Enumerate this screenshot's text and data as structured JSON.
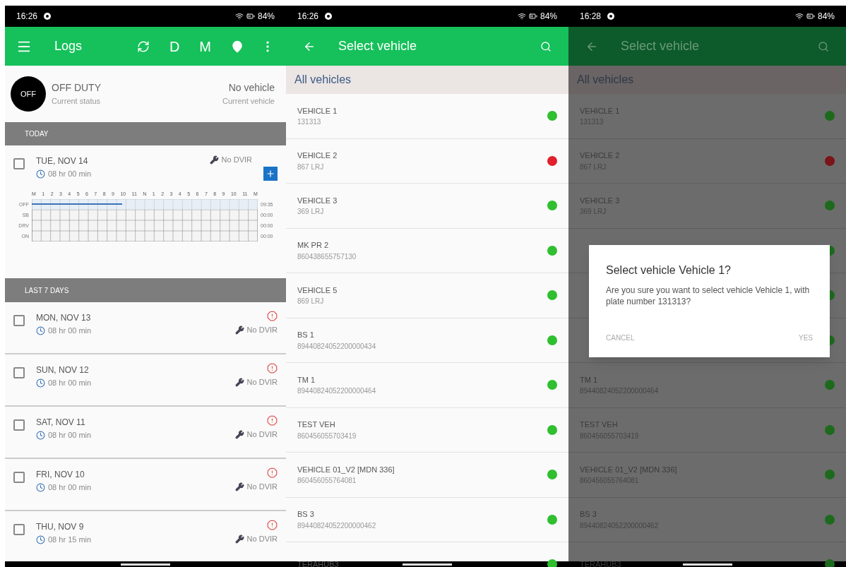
{
  "screens": [
    {
      "kind": "logs",
      "status_bar": {
        "time": "16:26",
        "battery": "84%"
      },
      "toolbar": {
        "title": "Logs",
        "actions": [
          "D",
          "M"
        ]
      },
      "current": {
        "badge": "OFF",
        "status": "OFF DUTY",
        "status_caption": "Current status",
        "vehicle": "No vehicle",
        "vehicle_caption": "Current vehicle"
      },
      "today": {
        "header": "TODAY",
        "day": {
          "date": "TUE, NOV 14",
          "checked": false,
          "duration": "08 hr 00 min",
          "dvir": "No DVIR"
        },
        "grid": {
          "hours": [
            "M",
            "1",
            "2",
            "3",
            "4",
            "5",
            "6",
            "7",
            "8",
            "9",
            "10",
            "11",
            "N",
            "1",
            "2",
            "3",
            "4",
            "5",
            "6",
            "7",
            "8",
            "9",
            "10",
            "11",
            "M"
          ],
          "rows": [
            {
              "label": "OFF",
              "total": "09:35",
              "level": 0.4
            },
            {
              "label": "SB",
              "total": "00:00"
            },
            {
              "label": "DRV",
              "total": "00:00"
            },
            {
              "label": "ON",
              "total": "00:00"
            }
          ]
        }
      },
      "last7": {
        "header": "LAST 7 DAYS",
        "days": [
          {
            "date": "MON, NOV 13",
            "checked": false,
            "duration": "08 hr 00 min",
            "dvir": "No DVIR"
          },
          {
            "date": "SUN, NOV 12",
            "checked": false,
            "duration": "08 hr 00 min",
            "dvir": "No DVIR"
          },
          {
            "date": "SAT, NOV 11",
            "checked": false,
            "duration": "08 hr 00 min",
            "dvir": "No DVIR"
          },
          {
            "date": "FRI, NOV 10",
            "checked": false,
            "duration": "08 hr 00 min",
            "dvir": "No DVIR"
          },
          {
            "date": "THU, NOV 9",
            "checked": false,
            "duration": "08 hr 15 min",
            "dvir": "No DVIR"
          }
        ]
      }
    },
    {
      "kind": "vehicles",
      "dimmed": false,
      "status_bar": {
        "time": "16:26",
        "battery": "84%"
      },
      "toolbar": {
        "title": "Select vehicle"
      },
      "section": "All vehicles",
      "vehicles": [
        {
          "kind": "row",
          "name": "VEHICLE 1",
          "plate": "131313",
          "color": "#2fbf2f"
        },
        {
          "kind": "row",
          "name": "VEHICLE 2",
          "plate": "867 LRJ",
          "color": "#e0202c"
        },
        {
          "kind": "row",
          "name": "VEHICLE 3",
          "plate": "369 LRJ",
          "color": "#2fbf2f"
        },
        {
          "kind": "row",
          "name": "MK PR 2",
          "plate": "860438655757130",
          "color": "#2fbf2f"
        },
        {
          "kind": "row",
          "name": "VEHICLE 5",
          "plate": "869 LRJ",
          "color": "#2fbf2f"
        },
        {
          "kind": "row",
          "name": "BS 1",
          "plate": "89440824052200000434",
          "color": "#2fbf2f"
        },
        {
          "kind": "row",
          "name": "TM 1",
          "plate": "89440824052200000464",
          "color": "#2fbf2f"
        },
        {
          "kind": "row",
          "name": "TEST VEH",
          "plate": "860456055703419",
          "color": "#2fbf2f"
        },
        {
          "kind": "row",
          "name": "VEHICLE 01_V2 [MDN 336]",
          "plate": "860456055764081",
          "color": "#2fbf2f"
        },
        {
          "kind": "row",
          "name": "BS 3",
          "plate": "89440824052200000462",
          "color": "#2fbf2f"
        },
        {
          "kind": "row",
          "name": "TERAHUB3",
          "color": "#2fbf2f"
        }
      ]
    },
    {
      "kind": "vehicles",
      "dimmed": true,
      "status_bar": {
        "time": "16:28",
        "battery": "84%"
      },
      "toolbar": {
        "title": "Select vehicle"
      },
      "section": "All vehicles",
      "vehicles": [
        {
          "kind": "row",
          "name": "VEHICLE 1",
          "plate": "131313",
          "color": "#1d6a1d"
        },
        {
          "kind": "row",
          "name": "VEHICLE 2",
          "plate": "867 LRJ",
          "color": "#7a1418"
        },
        {
          "kind": "row",
          "name": "VEHICLE 3",
          "plate": "369 LRJ",
          "color": "#1d6a1d"
        },
        {
          "kind": "covered",
          "color": "#1d6a1d"
        },
        {
          "kind": "covered",
          "color": "#1d6a1d"
        },
        {
          "kind": "covered",
          "color": "#1d6a1d"
        },
        {
          "kind": "row",
          "name": "TM 1",
          "plate": "89440824052200000464",
          "color": "#1d6a1d"
        },
        {
          "kind": "row",
          "name": "TEST VEH",
          "plate": "860456055703419",
          "color": "#1d6a1d"
        },
        {
          "kind": "row",
          "name": "VEHICLE 01_V2 [MDN 336]",
          "plate": "860456055764081",
          "color": "#1d6a1d"
        },
        {
          "kind": "row",
          "name": "BS 3",
          "plate": "89440824052200000462",
          "color": "#1d6a1d"
        },
        {
          "kind": "row",
          "name": "TERAHUB3",
          "color": "#1d6a1d"
        }
      ],
      "dialog": {
        "title": "Select vehicle Vehicle 1?",
        "message": "Are you sure you want to select vehicle Vehicle 1, with plate number 131313?",
        "buttons": [
          "CANCEL",
          "YES"
        ]
      }
    }
  ]
}
